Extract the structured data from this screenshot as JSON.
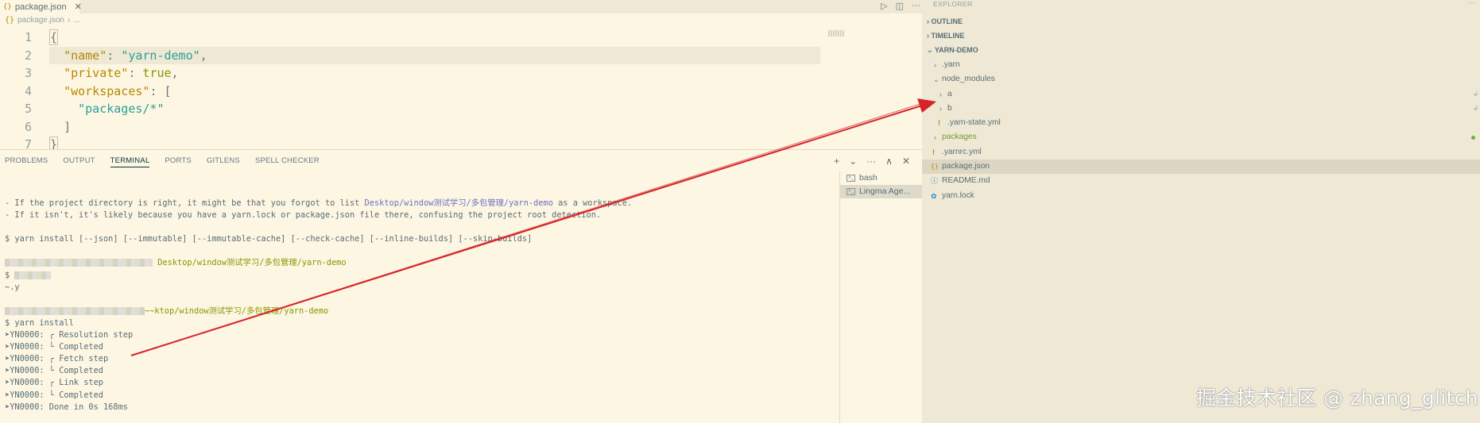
{
  "editor": {
    "tab_label": "package.json",
    "tab_icon": "{}",
    "breadcrumb_file": "package.json",
    "breadcrumb_more": "...",
    "tab_actions": [
      "▷",
      "◫",
      "···"
    ],
    "lines": [
      {
        "n": "1"
      },
      {
        "n": "2"
      },
      {
        "n": "3"
      },
      {
        "n": "4"
      },
      {
        "n": "5"
      },
      {
        "n": "6"
      },
      {
        "n": "7"
      }
    ],
    "code": {
      "l1": "{",
      "l2_key": "\"name\"",
      "l2_sep": ": ",
      "l2_val": "\"yarn-demo\"",
      "l2_end": ",",
      "l3_key": "\"private\"",
      "l3_sep": ": ",
      "l3_val": "true",
      "l3_end": ",",
      "l4_key": "\"workspaces\"",
      "l4_sep": ": ",
      "l4_val": "[",
      "l5_val": "\"packages/*\"",
      "l6": "]",
      "l7": "}"
    }
  },
  "panel": {
    "tabs": [
      "PROBLEMS",
      "OUTPUT",
      "TERMINAL",
      "PORTS",
      "GITLENS",
      "SPELL CHECKER"
    ],
    "active_tab": "TERMINAL",
    "actions": [
      "+",
      "⌄",
      "···",
      "∧",
      "✕"
    ],
    "terminals": [
      "bash",
      "Lingma Age..."
    ],
    "terminal": {
      "l1_a": "- If the project directory is right, it might be that you forgot to list ",
      "l1_link": "Desktop/window测试学习/多包管理/yarn-demo",
      "l1_b": " as a workspace.",
      "l2": "- If it isn't, it's likely because you have a yarn.lock or package.json file there, confusing the project root detection.",
      "l3": "$ yarn install [--json] [--immutable] [--immutable-cache] [--check-cache] [--inline-builds] [--skip-builds]",
      "path1": "Desktop/window测试学习/多包管理/yarn-demo",
      "l6": "$",
      "l7": "~.y",
      "path2": "~~ktop/window测试学习/多包管理/yarn-demo",
      "cmd": "$ yarn install",
      "out": [
        "➤YN0000: ┌ Resolution step",
        "➤YN0000: └ Completed",
        "➤YN0000: ┌ Fetch step",
        "➤YN0000: └ Completed",
        "➤YN0000: ┌ Link step",
        "➤YN0000: └ Completed",
        "➤YN0000: Done in 0s 168ms"
      ]
    }
  },
  "sidebar": {
    "title": "EXPLORER",
    "title_more": "···",
    "outline": "OUTLINE",
    "timeline": "TIMELINE",
    "project": "YARN-DEMO",
    "tree": {
      "yarn": ".yarn",
      "node_modules": "node_modules",
      "a": "a",
      "b": "b",
      "yarn_state": ".yarn-state.yml",
      "packages": "packages",
      "yarnrc": ".yarnrc.yml",
      "package_json": "package.json",
      "readme": "README.md",
      "yarn_lock": "yarn.lock"
    }
  },
  "watermark": "掘金技术社区 @ zhang_glitch",
  "colors": {
    "background": "#fdf6e3",
    "sidebar": "#eee8d5",
    "key": "#b58900",
    "string": "#2aa198",
    "boolean": "#859900",
    "arrow": "#d6242a"
  }
}
